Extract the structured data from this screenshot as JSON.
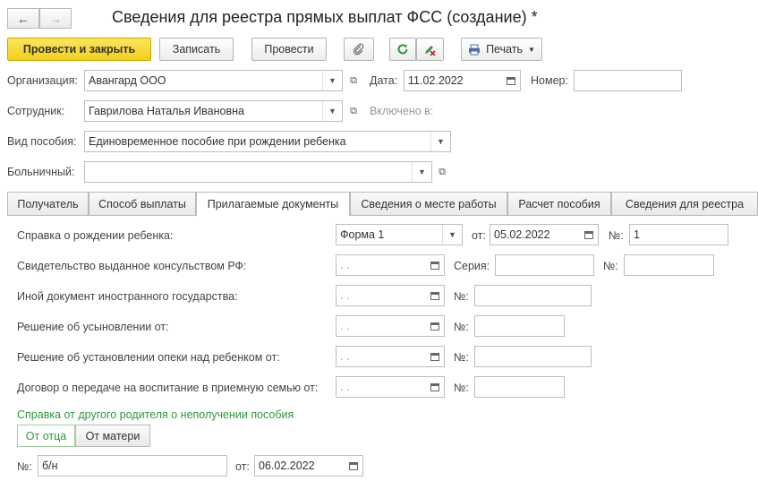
{
  "nav": {
    "back_icon": "arrow-left-icon",
    "forward_icon": "arrow-right-icon"
  },
  "title": "Сведения для реестра прямых выплат ФСС (создание) *",
  "toolbar": {
    "post_close": "Провести и закрыть",
    "save": "Записать",
    "post": "Провести",
    "attach_icon": "paperclip-icon",
    "refresh_icon": "refresh-icon",
    "edit_icon": "edit-document-icon",
    "print_icon": "printer-icon",
    "print": "Печать",
    "accent": "#f2cf1a",
    "refresh_color": "#2b9a3c"
  },
  "header": {
    "org_label": "Организация:",
    "org_value": "Авангард ООО",
    "date_label": "Дата:",
    "date_value": "11.02.2022",
    "number_label": "Номер:",
    "number_value": "",
    "employee_label": "Сотрудник:",
    "employee_value": "Гаврилова Наталья Ивановна",
    "included_label": "Включено в:",
    "benefit_label": "Вид пособия:",
    "benefit_value": "Единовременное пособие при рождении ребенка",
    "sick_label": "Больничный:",
    "sick_value": ""
  },
  "tabs": [
    {
      "label": "Получатель"
    },
    {
      "label": "Способ выплаты"
    },
    {
      "label": "Прилагаемые документы"
    },
    {
      "label": "Сведения о месте работы"
    },
    {
      "label": "Расчет пособия"
    },
    {
      "label": "Сведения для реестра"
    }
  ],
  "docs": {
    "birth_cert_label": "Справка о рождении ребенка:",
    "birth_cert_form": "Форма 1",
    "from_label": "от:",
    "birth_cert_date": "05.02.2022",
    "no_label": "№:",
    "birth_cert_number": "1",
    "consul_label": "Свидетельство выданное консульством РФ:",
    "series_label": "Серия:",
    "foreign_label": "Иной документ иностранного государства:",
    "adoption_label": "Решение об усыновлении от:",
    "guardian_label": "Решение об установлении опеки над ребенком от:",
    "foster_label": "Договор о передаче на воспитание в приемную семью от:",
    "empty_date": " .  .",
    "other_parent_title": "Справка от другого родителя о неполучении пособия",
    "from_father": "От отца",
    "from_mother": "От матери",
    "cert_no_label": "№:",
    "cert_no_value": "б/н",
    "cert_from_label": "от:",
    "cert_date": "06.02.2022"
  }
}
